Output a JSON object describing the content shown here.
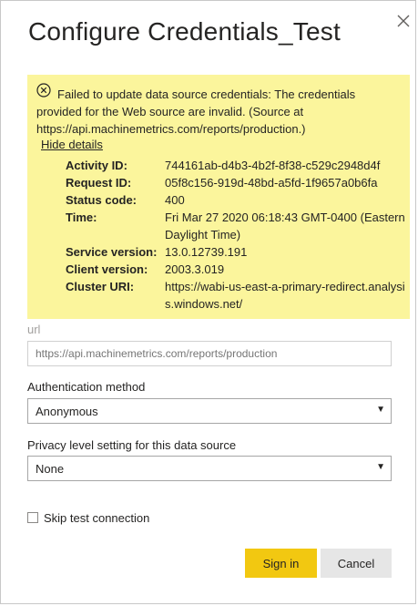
{
  "dialog": {
    "title": "Configure Credentials_Test",
    "close_icon": "close-icon"
  },
  "alert": {
    "icon": "error-circle-icon",
    "message": "Failed to update data source credentials: The credentials provided for the Web source are invalid. (Source at https://api.machinemetrics.com/reports/production.)",
    "hide_details": "Hide details",
    "details": [
      {
        "label": "Activity ID:",
        "value": "744161ab-d4b3-4b2f-8f38-c529c2948d4f"
      },
      {
        "label": "Request ID:",
        "value": "05f8c156-919d-48bd-a5fd-1f9657a0b6fa"
      },
      {
        "label": "Status code:",
        "value": "400"
      },
      {
        "label": "Time:",
        "value": "Fri Mar 27 2020 06:18:43 GMT-0400 (Eastern Daylight Time)"
      },
      {
        "label": "Service version:",
        "value": "13.0.12739.191"
      },
      {
        "label": "Client version:",
        "value": "2003.3.019"
      },
      {
        "label": "Cluster URI:",
        "value": "https://wabi-us-east-a-primary-redirect.analysis.windows.net/"
      }
    ],
    "background": "#fbf59c"
  },
  "form": {
    "url_label": "url",
    "url_placeholder": "https://api.machinemetrics.com/reports/production",
    "auth_label": "Authentication method",
    "auth_value": "Anonymous",
    "privacy_label": "Privacy level setting for this data source",
    "privacy_value": "None",
    "skip_test_label": "Skip test connection",
    "skip_test_checked": false
  },
  "buttons": {
    "sign_in": "Sign in",
    "cancel": "Cancel",
    "accent": "#f2c811"
  }
}
